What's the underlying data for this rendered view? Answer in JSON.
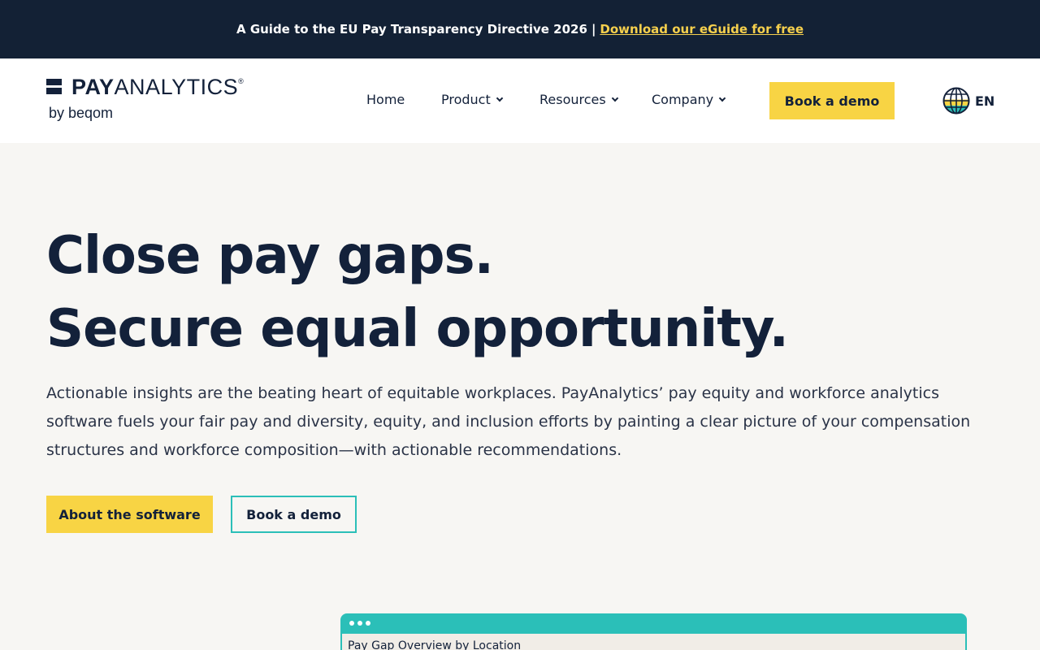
{
  "banner": {
    "text": "A Guide to the EU Pay Transparency Directive 2026",
    "separator": "|",
    "link_text": "Download our eGuide for free"
  },
  "logo": {
    "word_bold": "PAY",
    "word_light": "ANALYTICS",
    "registered": "®",
    "byline": "by beqom"
  },
  "nav": {
    "items": [
      {
        "label": "Home",
        "has_dropdown": false
      },
      {
        "label": "Product",
        "has_dropdown": true
      },
      {
        "label": "Resources",
        "has_dropdown": true
      },
      {
        "label": "Company",
        "has_dropdown": true
      }
    ],
    "demo_button": "Book a demo",
    "language": "EN"
  },
  "hero": {
    "title_line1": "Close pay gaps.",
    "title_line2": "Secure equal opportunity.",
    "paragraph": "Actionable insights are the beating heart of equitable workplaces. PayAnalytics’ pay equity and workforce analytics software fuels your fair pay and diversity, equity, and inclusion efforts by painting a clear picture of your compensation structures and workforce composition—with actionable recommendations.",
    "primary_cta": "About the software",
    "secondary_cta": "Book a demo"
  },
  "preview": {
    "window_title": "Pay Gap Overview by Location"
  },
  "colors": {
    "navy": "#132135",
    "accent_yellow": "#f8d444",
    "accent_teal": "#2bbfb8",
    "background": "#f7f6f3"
  }
}
